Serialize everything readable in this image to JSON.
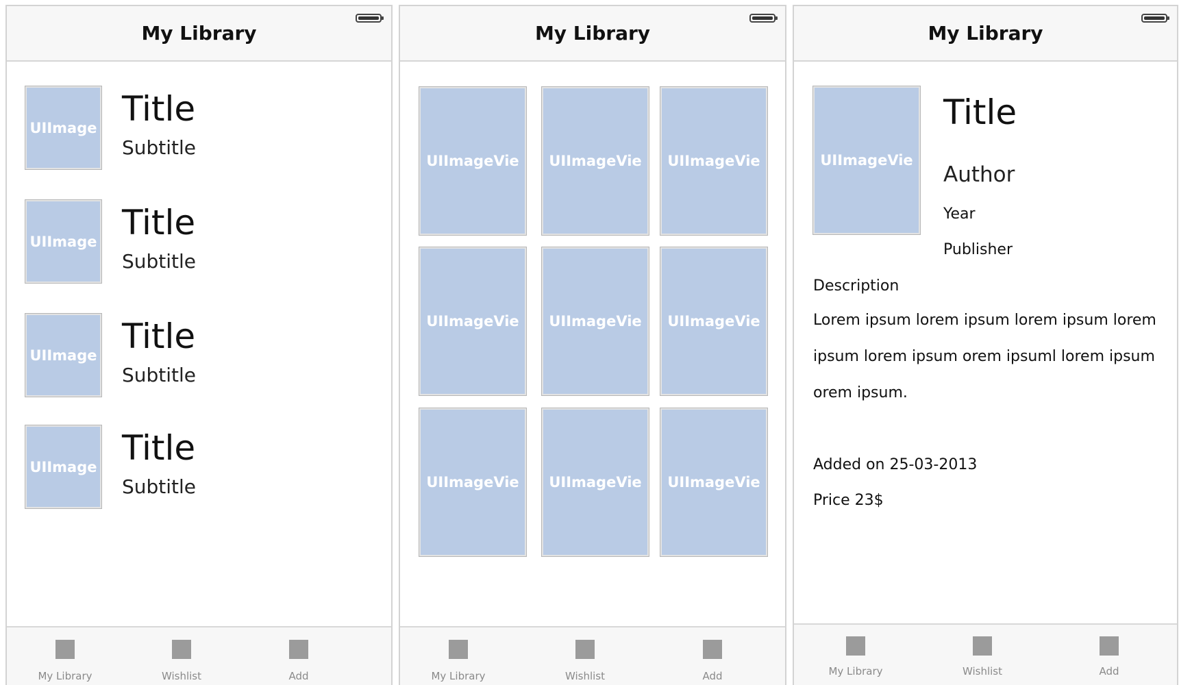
{
  "screens": [
    {
      "nav_title": "My Library",
      "cells": [
        {
          "image_label": "UIImage",
          "title": "Title",
          "subtitle": "Subtitle"
        },
        {
          "image_label": "UIImage",
          "title": "Title",
          "subtitle": "Subtitle"
        },
        {
          "image_label": "UIImage",
          "title": "Title",
          "subtitle": "Subtitle"
        },
        {
          "image_label": "UIImage",
          "title": "Title",
          "subtitle": "Subtitle"
        }
      ]
    },
    {
      "nav_title": "My Library",
      "grid": [
        "UIImageVie",
        "UIImageVie",
        "UIImageVie",
        "UIImageVie",
        "UIImageVie",
        "UIImageVie",
        "UIImageVie",
        "UIImageVie",
        "UIImageVie"
      ]
    },
    {
      "nav_title": "My Library",
      "detail": {
        "image_label": "UIImageVie",
        "title": "Title",
        "author": "Author",
        "year": "Year",
        "publisher": "Publisher",
        "description_heading": "Description",
        "description_lines": [
          "Lorem ipsum lorem ipsum lorem ipsum lorem",
          "ipsum lorem ipsum orem ipsuml lorem ipsum",
          "orem ipsum."
        ],
        "added_on": "Added on 25-03-2013",
        "price": "Price 23$"
      }
    }
  ],
  "tabs": [
    {
      "label": "My Library",
      "icon": "placeholder-square-icon"
    },
    {
      "label": "Wishlist",
      "icon": "placeholder-square-icon"
    },
    {
      "label": "Add",
      "icon": "placeholder-square-icon"
    }
  ],
  "colors": {
    "image_placeholder": "#b9cbe5",
    "bar_background": "#f7f7f7",
    "tab_icon": "#9b9b9b",
    "tab_label": "#8a8a8a"
  }
}
